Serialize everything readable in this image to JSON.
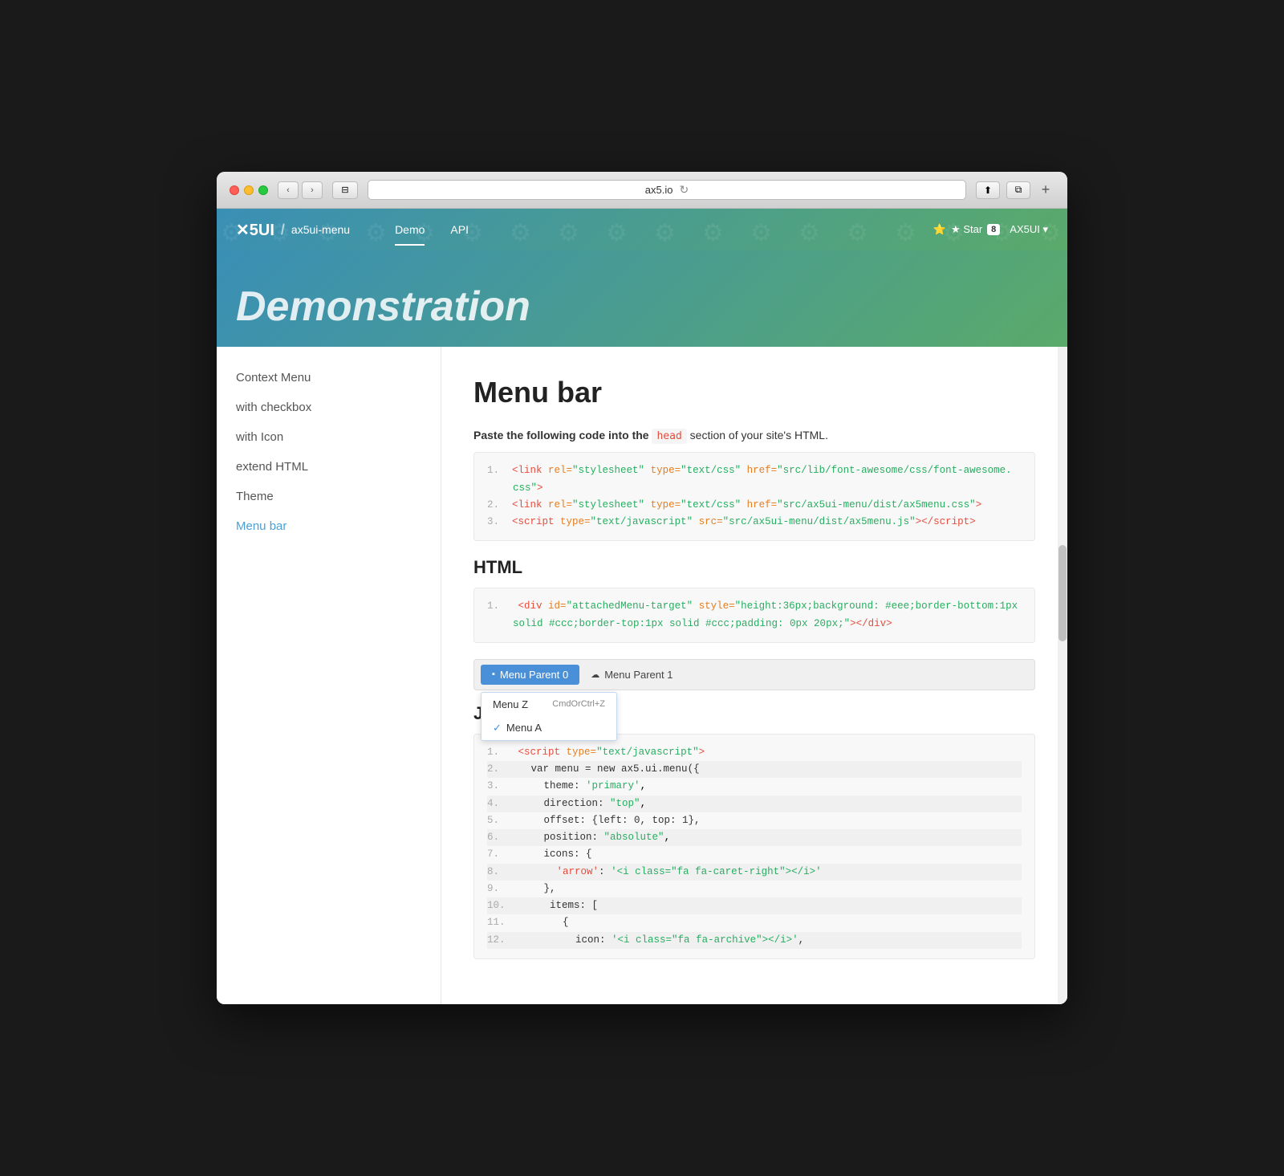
{
  "browser": {
    "url": "ax5.io",
    "traffic_lights": [
      "red",
      "yellow",
      "green"
    ]
  },
  "site": {
    "logo_mark": "✕5UI",
    "logo_separator": "/",
    "logo_sub": "ax5ui-menu",
    "nav_items": [
      {
        "label": "Demo",
        "active": true
      },
      {
        "label": "API",
        "active": false
      }
    ],
    "github_label": "★ Star",
    "star_count": "8",
    "ax5ui_label": "AX5UI ▾"
  },
  "demo_banner": {
    "title": "Demonstration"
  },
  "sidebar": {
    "items": [
      {
        "label": "Context Menu",
        "active": false
      },
      {
        "label": "with checkbox",
        "active": false
      },
      {
        "label": "with Icon",
        "active": false
      },
      {
        "label": "extend HTML",
        "active": false
      },
      {
        "label": "Theme",
        "active": false
      },
      {
        "label": "Menu bar",
        "active": true
      }
    ]
  },
  "content": {
    "page_title": "Menu bar",
    "intro_text": "Paste the following code into the",
    "intro_highlight": "head",
    "intro_text2": "section of your site's HTML.",
    "head_section_label": "HTML",
    "js_section_label": "JS",
    "head_code": [
      {
        "num": "1.",
        "text": "<link rel=\"stylesheet\" type=\"text/css\" href=\"src/lib/font-awesome/css/font-awesome.css\">"
      },
      {
        "num": "2.",
        "text": "<link rel=\"stylesheet\" type=\"text/css\" href=\"src/ax5ui-menu/dist/ax5menu.css\">"
      },
      {
        "num": "3.",
        "text": "<script type=\"text/javascript\" src=\"src/ax5ui-menu/dist/ax5menu.js\"></script>"
      }
    ],
    "html_code": [
      {
        "num": "1.",
        "text": "<div id=\"attachedMenu-target\" style=\"height:36px;background: #eee;border-bottom:1px solid #ccc;border-top:1px solid #ccc;padding: 0px 20px;\"></div>"
      }
    ],
    "menu_demo": {
      "parent0_label": "Menu Parent 0",
      "parent1_label": "Menu Parent 1",
      "dropdown_items": [
        {
          "label": "Menu Z",
          "shortcut": "CmdOrCtrl+Z",
          "checked": false
        },
        {
          "label": "Menu A",
          "checked": true
        }
      ]
    },
    "js_code": [
      {
        "num": "1.",
        "text": "<script type=\"text/javascript\">"
      },
      {
        "num": "2.",
        "text": "    var menu = new ax5.ui.menu({"
      },
      {
        "num": "3.",
        "text": "        theme: 'primary',"
      },
      {
        "num": "4.",
        "text": "        direction: \"top\","
      },
      {
        "num": "5.",
        "text": "        offset: {left: 0, top: 1},"
      },
      {
        "num": "6.",
        "text": "        position: \"absolute\","
      },
      {
        "num": "7.",
        "text": "        icons: {"
      },
      {
        "num": "8.",
        "text": "            'arrow': '<i class=\"fa fa-caret-right\"></i>'"
      },
      {
        "num": "9.",
        "text": "        },"
      },
      {
        "num": "10.",
        "text": "        items: ["
      },
      {
        "num": "11.",
        "text": "            {"
      },
      {
        "num": "12.",
        "text": "                icon: '<i class=\"fa fa-archive\"></i>',"
      }
    ]
  }
}
